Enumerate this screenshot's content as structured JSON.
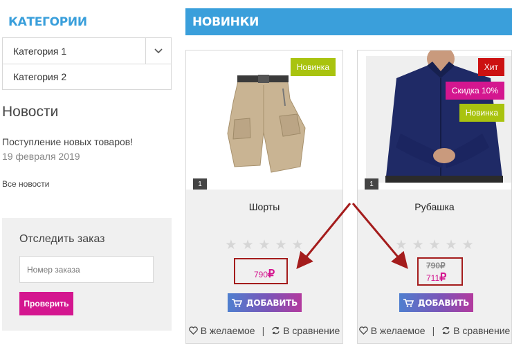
{
  "sidebar": {
    "categories_title": "КАТЕГОРИИ",
    "categories": [
      {
        "label": "Категория 1",
        "has_children": true
      },
      {
        "label": "Категория 2",
        "has_children": false
      }
    ],
    "news": {
      "title": "Новости",
      "item": "Поступление новых товаров!",
      "date": "19 февраля 2019",
      "all_link": "Все новости"
    },
    "track": {
      "title": "Отследить заказ",
      "placeholder": "Номер заказа",
      "button": "Проверить"
    }
  },
  "main": {
    "header": "НОВИНКИ",
    "products": [
      {
        "name": "Шорты",
        "badges": [
          "Новинка"
        ],
        "photo_count": "1",
        "rating": 0,
        "price": "790",
        "currency": "₽",
        "add_label": "ДОБАВИТЬ",
        "wishlist": "В желаемое",
        "compare": "В сравнение"
      },
      {
        "name": "Рубашка",
        "badges": [
          "Хит",
          "Скидка 10%",
          "Новинка"
        ],
        "photo_count": "1",
        "rating": 0,
        "old_price": "790",
        "price": "711",
        "currency": "₽",
        "add_label": "ДОБАВИТЬ",
        "wishlist": "В желаемое",
        "compare": "В сравнение"
      }
    ]
  },
  "colors": {
    "accent_blue": "#3a9fdb",
    "magenta": "#d4168f",
    "badge_new": "#a9c30f",
    "badge_hit": "#cc1111",
    "annotation_red": "#a41c1c"
  }
}
